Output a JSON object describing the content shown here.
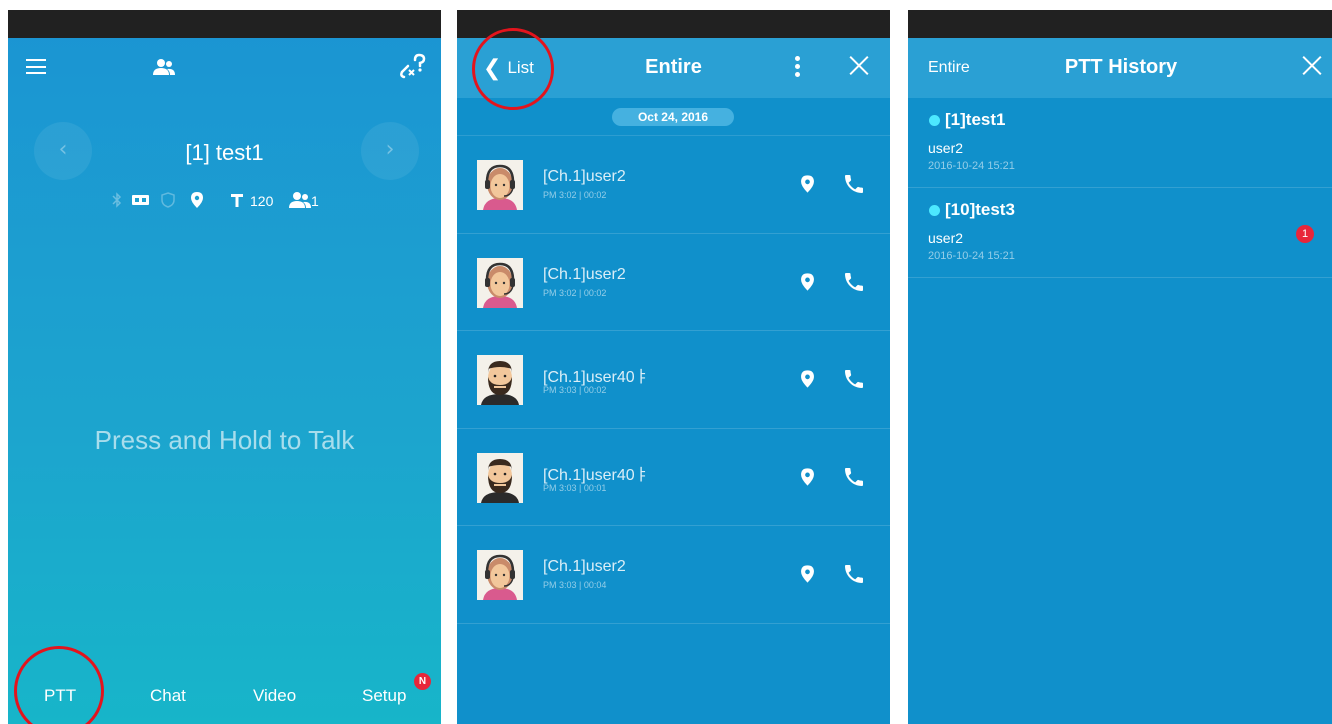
{
  "colors": {
    "screen_bg": "#1090cb",
    "header_bg": "#2aa0d4",
    "status_bar": "#212121",
    "annotation_ring": "#e3141d",
    "badge_red": "#e8263a",
    "online_dot": "#4ce8ff"
  },
  "ptt_screen": {
    "header": {
      "menu_icon": "hamburger-menu-icon",
      "contacts_icon": "contacts-icon",
      "disconnected_icon": "unlink-question-icon"
    },
    "channel_title": "[1] test1",
    "status": {
      "icons": [
        "bluetooth-icon",
        "battery-icon",
        "shield-icon",
        "location-pin-icon",
        "text-size-icon",
        "users-icon"
      ],
      "timer_value": "120",
      "member_count": "1"
    },
    "press_hint": "Press and Hold to Talk",
    "tabs": [
      {
        "label": "PTT"
      },
      {
        "label": "Chat"
      },
      {
        "label": "Video"
      },
      {
        "label": "Setup",
        "badge": "N"
      }
    ]
  },
  "log_screen": {
    "back_label": "List",
    "title": "Entire",
    "date_label": "Oct 24, 2016",
    "entries": [
      {
        "name": "[Ch.1]user2",
        "meta": "PM 3:02 | 00:02",
        "avatar": "woman-headset-avatar"
      },
      {
        "name": "[Ch.1]user2",
        "meta": "PM 3:02 | 00:02",
        "avatar": "woman-headset-avatar"
      },
      {
        "name": "[Ch.1]user40ㅑ",
        "meta": "PM 3:03 | 00:02",
        "avatar": "bearded-man-avatar"
      },
      {
        "name": "[Ch.1]user40ㅑ",
        "meta": "PM 3:03 | 00:01",
        "avatar": "bearded-man-avatar"
      },
      {
        "name": "[Ch.1]user2",
        "meta": "PM 3:03 | 00:04",
        "avatar": "woman-headset-avatar"
      }
    ]
  },
  "history_screen": {
    "left_label": "Entire",
    "title": "PTT History",
    "items": [
      {
        "channel": "[1]test1",
        "user": "user2",
        "time": "2016-10-24 15:21",
        "unread": ""
      },
      {
        "channel": "[10]test3",
        "user": "user2",
        "time": "2016-10-24 15:21",
        "unread": "1"
      }
    ]
  }
}
